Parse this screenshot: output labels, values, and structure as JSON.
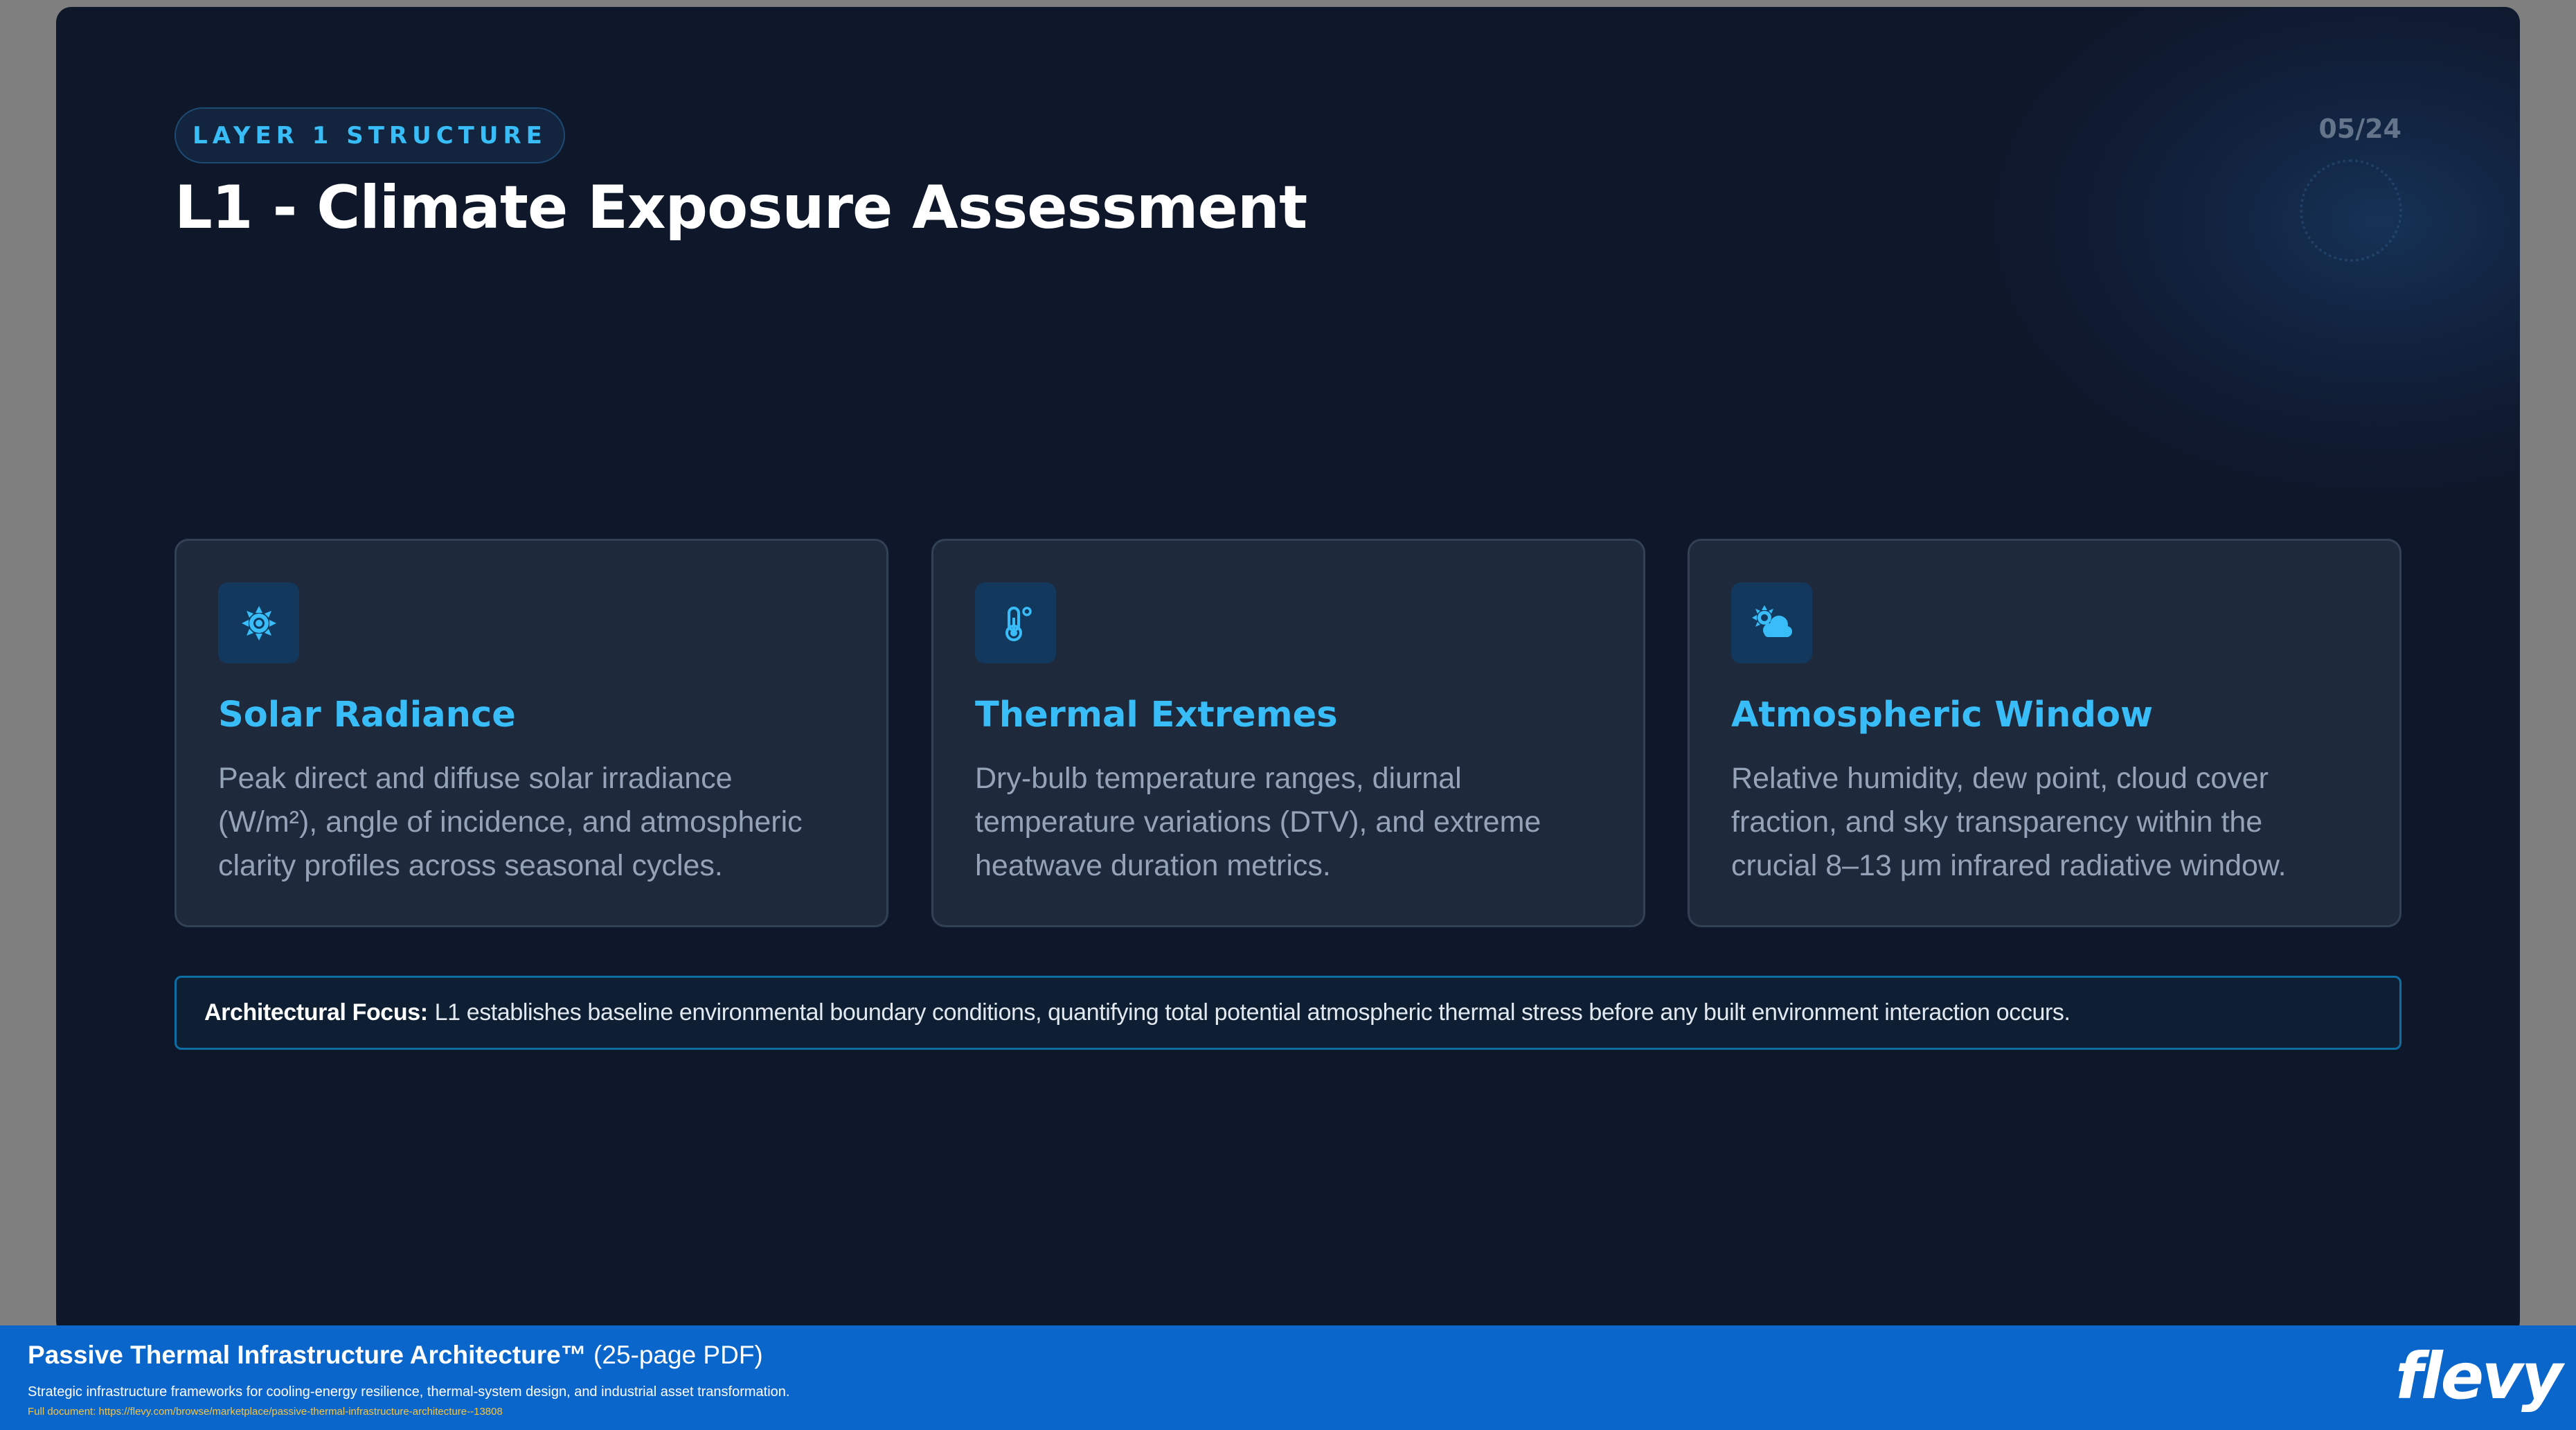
{
  "slide": {
    "badge": "LAYER 1 STRUCTURE",
    "page_number": "05/24",
    "title": "L1 - Climate Exposure Assessment",
    "cards": [
      {
        "icon": "sun-gear-icon",
        "title": "Solar Radiance",
        "lines": [
          "Peak direct and diffuse solar irradiance",
          "(W/m²), angle of incidence, and atmospheric",
          "clarity profiles across seasonal cycles."
        ]
      },
      {
        "icon": "thermometer-icon",
        "title": "Thermal Extremes",
        "lines": [
          "Dry-bulb temperature ranges, diurnal",
          "temperature variations (DTV), and extreme",
          "heatwave duration metrics."
        ]
      },
      {
        "icon": "cloud-sun-icon",
        "title": "Atmospheric Window",
        "lines": [
          "Relative humidity, dew point, cloud cover",
          "fraction, and sky transparency within the",
          "crucial 8–13 μm infrared radiative window."
        ]
      }
    ],
    "focus": {
      "label": "Architectural Focus:",
      "text": "L1 establishes baseline environmental boundary conditions, quantifying total potential atmospheric thermal stress before any built environment interaction occurs."
    }
  },
  "footer": {
    "title": "Passive Thermal Infrastructure Architecture™",
    "title_suffix": "(25-page PDF)",
    "subtitle": "Strategic infrastructure frameworks for cooling-energy resilience, thermal-system design, and industrial asset transformation.",
    "link": "Full document: https://flevy.com/browse/marketplace/passive-thermal-infrastructure-architecture--13808",
    "logo": "flevy"
  },
  "colors": {
    "slide_bg": "#0f172a",
    "card_bg": "#1e293b",
    "accent": "#38bdf8",
    "footer_bg": "#0b66cc"
  }
}
